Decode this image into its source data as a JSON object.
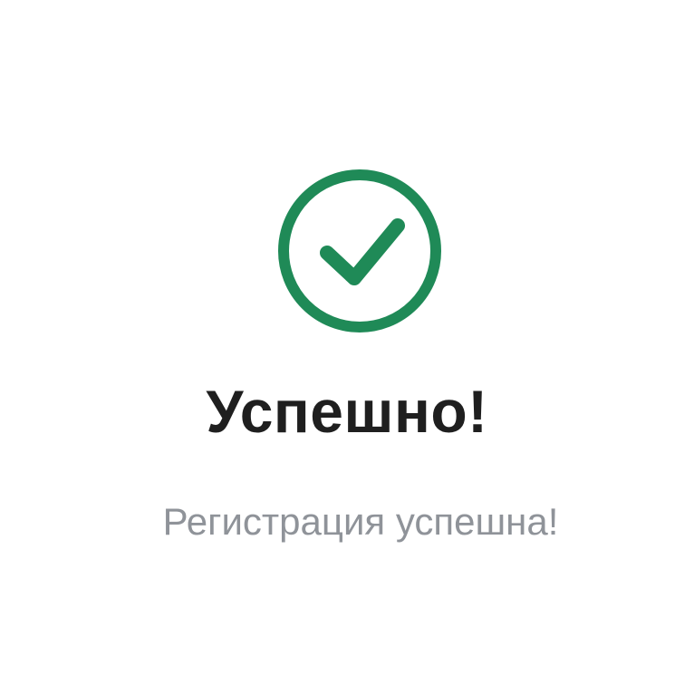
{
  "dialog": {
    "icon": "check-circle-icon",
    "title": "Успешно!",
    "message": "Регистрация успешна!"
  },
  "colors": {
    "accent": "#1f8a57",
    "title": "#1f1f1f",
    "message": "#8f9399",
    "background": "#ffffff"
  }
}
